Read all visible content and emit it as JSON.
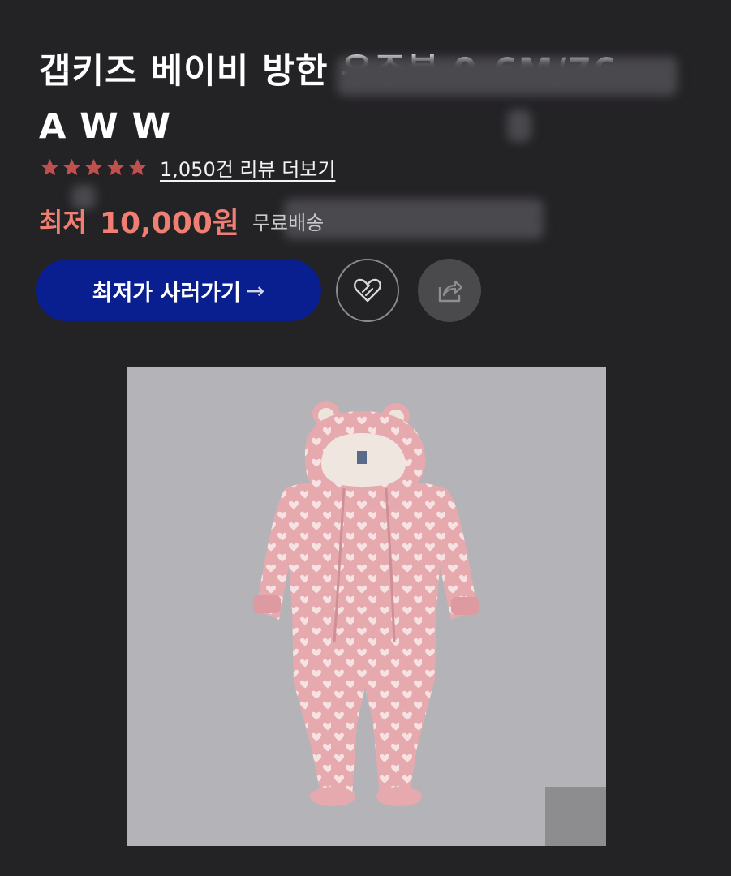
{
  "product": {
    "title_line1": "갭키즈 베이비 방한 우주복 0-6M/76",
    "title_line2": "A W W"
  },
  "rating": {
    "stars": 5,
    "review_link": "1,050건 리뷰 더보기"
  },
  "price": {
    "label": "최저",
    "value": "10,000원",
    "shipping": "무료배송"
  },
  "actions": {
    "buy_label": "최저가 사러가기",
    "buy_arrow": "→"
  },
  "icons": {
    "like": "heart-icon",
    "share": "share-icon",
    "star": "star-icon"
  },
  "colors": {
    "background": "#232225",
    "accent_price": "#ef7f73",
    "buy_button": "#0a1f8f",
    "star": "#c0504d",
    "product_bg": "#b4b4b8",
    "product_pink": "#e8a8ae"
  }
}
